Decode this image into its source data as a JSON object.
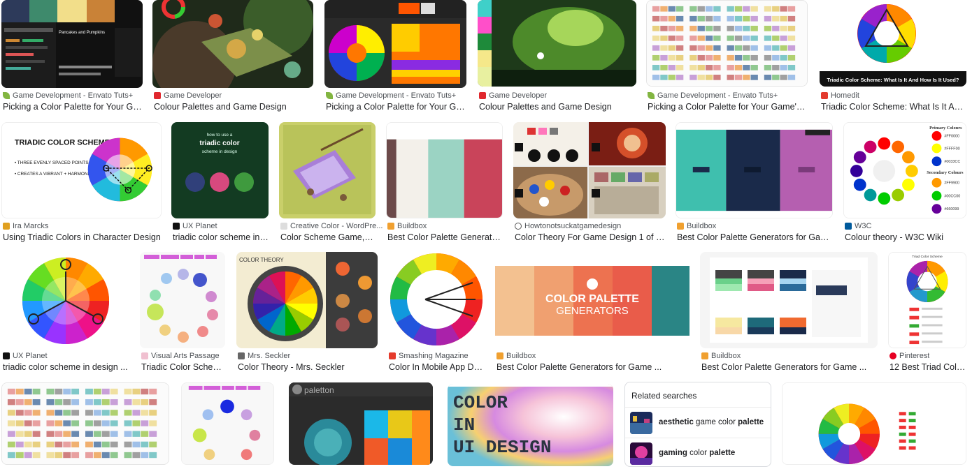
{
  "results": [
    {
      "source": "Game Development - Envato Tuts+",
      "title": "Picking a Color Palette for Your Game...",
      "fav": "leaf-icon",
      "favColor": "#82b541"
    },
    {
      "source": "Game Developer",
      "title": "Colour Palettes and Game Design",
      "fav": "gd-icon",
      "favColor": "#e0282e"
    },
    {
      "source": "Game Development - Envato Tuts+",
      "title": "Picking a Color Palette for Your Game'...",
      "fav": "leaf-icon",
      "favColor": "#82b541"
    },
    {
      "source": "Game Developer",
      "title": "Colour Palettes and Game Design",
      "fav": "gd-icon",
      "favColor": "#e0282e"
    },
    {
      "source": "Game Development - Envato Tuts+",
      "title": "Picking a Color Palette for Your Game's ...",
      "fav": "leaf-icon",
      "favColor": "#82b541"
    },
    {
      "source": "Homedit",
      "title": "Triadic Color Scheme: What Is It And ...",
      "fav": "homedit-icon",
      "favColor": "#e33b2e"
    },
    {
      "source": "Ira Marcks",
      "title": "Using Triadic Colors in Character Design",
      "fav": "ira-icon",
      "favColor": "#e0a020"
    },
    {
      "source": "UX Planet",
      "title": "triadic color scheme in de...",
      "fav": "uxplanet-icon",
      "favColor": "#111111"
    },
    {
      "source": "Creative Color - WordPre...",
      "title": "Color Scheme Game, Se...",
      "fav": "creative-icon",
      "favColor": "#dddddd"
    },
    {
      "source": "Buildbox",
      "title": "Best Color Palette Generators f...",
      "fav": "buildbox-icon",
      "favColor": "#f0a030"
    },
    {
      "source": "Howtonotsuckatgamedesign",
      "title": "Color Theory For Game Design 1 of 4 ...",
      "fav": "globe-icon",
      "favColor": "#555555"
    },
    {
      "source": "Buildbox",
      "title": "Best Color Palette Generators for Game ...",
      "fav": "buildbox-icon",
      "favColor": "#f0a030"
    },
    {
      "source": "W3C",
      "title": "Colour theory - W3C Wiki",
      "fav": "w3c-icon",
      "favColor": "#005a9c"
    },
    {
      "source": "UX Planet",
      "title": "triadic color scheme in design ...",
      "fav": "uxplanet-icon",
      "favColor": "#111111"
    },
    {
      "source": "Visual Arts Passage",
      "title": "Triadic Color Scheme...",
      "fav": "vap-icon",
      "favColor": "#f0c0d0"
    },
    {
      "source": "Mrs. Seckler",
      "title": "Color Theory - Mrs. Seckler",
      "fav": "seckler-icon",
      "favColor": "#666666"
    },
    {
      "source": "Smashing Magazine",
      "title": "Color In Mobile App Desi...",
      "fav": "smashing-icon",
      "favColor": "#e53b2c"
    },
    {
      "source": "Buildbox",
      "title": "Best Color Palette Generators for Game ...",
      "fav": "buildbox-icon",
      "favColor": "#f0a030"
    },
    {
      "source": "Buildbox",
      "title": "Best Color Palette Generators for Game ...",
      "fav": "buildbox-icon",
      "favColor": "#f0a030"
    },
    {
      "source": "Pinterest",
      "title": "12 Best Triad Color ...",
      "fav": "pinterest-icon",
      "favColor": "#e60023"
    }
  ],
  "thumbText": {
    "pumpkins": "Pancakes and Pumpkins",
    "homedit_caption": "Triadic Color Scheme: What Is It And How Is It Used?",
    "triadic_title": "TRIADIC COLOR SCHEME",
    "triadic_b1": "• THREE EVENLY SPACED POINTS ON A COLOR WHEEL",
    "triadic_b2": "• CREATES A VIBRANT + HARMONIOUS SCHEME",
    "ux_line1": "how to use a",
    "ux_line2": "triadic color",
    "ux_line3": "scheme in design",
    "w3c_primary": "Primary Colours",
    "w3c_secondary": "Secondary Colours",
    "w3c_hex": [
      "#FF0000",
      "#FFFF00",
      "#0033CC",
      "#FF9900",
      "#00CC00",
      "#660099"
    ],
    "color_theory": "COLOR THEORY",
    "palette_gen_1": "COLOR PALETTE",
    "palette_gen_2": "GENERATORS",
    "pinterest_caption": "Triad Color Scheme",
    "paletton": "paletton",
    "ui_design": [
      "COLOR",
      "IN",
      "UI DESIGN"
    ]
  },
  "related": {
    "heading": "Related searches",
    "items": [
      {
        "bold": "aesthetic",
        "rest1": " game color ",
        "bold2": "palette",
        "rest2": ""
      },
      {
        "bold": "gaming",
        "rest1": " color ",
        "bold2": "palette",
        "rest2": ""
      }
    ]
  },
  "colors": {
    "text": "#202124",
    "source": "#4d5156",
    "border": "#dadce0"
  }
}
